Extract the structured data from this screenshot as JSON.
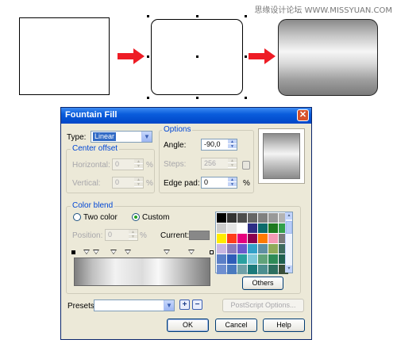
{
  "watermark": "思缘设计论坛 WWW.MISSYUAN.COM",
  "dialog": {
    "title": "Fountain Fill",
    "type_label": "Type:",
    "type_value": "Linear",
    "center_offset_title": "Center offset",
    "horizontal_label": "Horizontal:",
    "horizontal_value": "0",
    "vertical_label": "Vertical:",
    "vertical_value": "0",
    "percent": "%",
    "options_title": "Options",
    "angle_label": "Angle:",
    "angle_value": "-90,0",
    "steps_label": "Steps:",
    "steps_value": "256",
    "edge_pad_label": "Edge pad:",
    "edge_pad_value": "0",
    "color_blend_title": "Color blend",
    "two_color_label": "Two color",
    "custom_label": "Custom",
    "blend_mode": "custom",
    "position_label": "Position:",
    "position_value": "0",
    "current_label": "Current:",
    "current_color": "#888888",
    "others_label": "Others",
    "presets_label": "Presets:",
    "presets_value": "",
    "postscript_label": "PostScript Options...",
    "ok_label": "OK",
    "cancel_label": "Cancel",
    "help_label": "Help",
    "add_preset_icon": "plus-icon",
    "remove_preset_icon": "minus-icon",
    "palette_colors": [
      "#000000",
      "#333333",
      "#4d4d4d",
      "#666666",
      "#808080",
      "#999999",
      "#b3b3b3",
      "#cccccc",
      "#e5e5e5",
      "#ffffff",
      "#2d2d85",
      "#0b6b6b",
      "#1f7a1f",
      "#33a14b",
      "#ffec00",
      "#ff3d1a",
      "#e6007e",
      "#8c0050",
      "#ff7a00",
      "#f59ab5",
      "#7a7a7a",
      "#c8b6e2",
      "#8a7dbe",
      "#6a5acd",
      "#33a1c9",
      "#5f8fa3",
      "#8faa5a",
      "#3d6b5e",
      "#5b7fc7",
      "#2e5cb8",
      "#2aa0a0",
      "#7cc7d8",
      "#61a37a",
      "#2e8b57",
      "#1f5f4f",
      "#6f8fd0",
      "#4a7abf",
      "#6fa0a8",
      "#1c7a7a",
      "#4d8f8f",
      "#2d6f5f",
      "#3a4f3a"
    ]
  }
}
